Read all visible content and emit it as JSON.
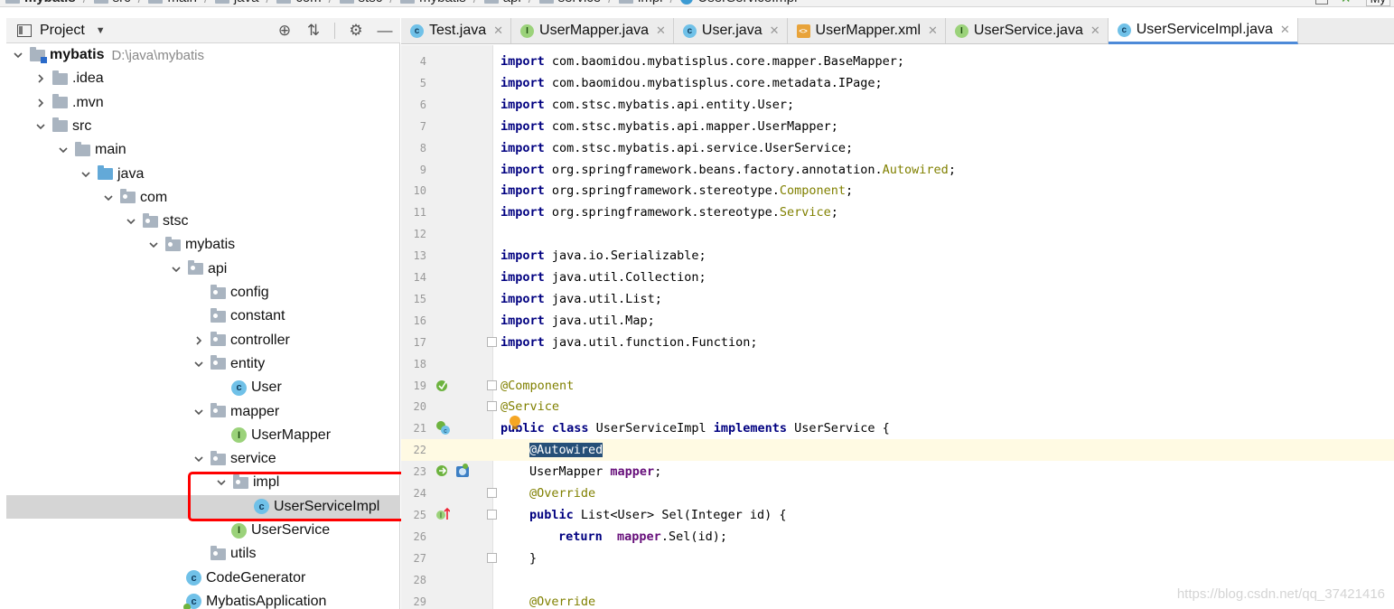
{
  "breadcrumb": {
    "items": [
      "mybatis",
      "src",
      "main",
      "java",
      "com",
      "stsc",
      "mybatis",
      "api",
      "service",
      "impl",
      "UserServiceImpl"
    ],
    "run_config": "My"
  },
  "project_panel": {
    "title": "Project",
    "tools": [
      "locate-icon",
      "collapse-icon",
      "gear-icon",
      "minimize-icon"
    ]
  },
  "tree": [
    {
      "label": "mybatis",
      "path": "D:\\java\\mybatis",
      "bold": true,
      "icon": "module-folder",
      "indent": 0,
      "arrow": "down"
    },
    {
      "label": ".idea",
      "icon": "folder",
      "indent": 1,
      "arrow": "right"
    },
    {
      "label": ".mvn",
      "icon": "folder",
      "indent": 1,
      "arrow": "right"
    },
    {
      "label": "src",
      "icon": "folder",
      "indent": 1,
      "arrow": "down"
    },
    {
      "label": "main",
      "icon": "folder",
      "indent": 2,
      "arrow": "down"
    },
    {
      "label": "java",
      "icon": "source-folder",
      "indent": 3,
      "arrow": "down"
    },
    {
      "label": "com",
      "icon": "package",
      "indent": 4,
      "arrow": "down"
    },
    {
      "label": "stsc",
      "icon": "package",
      "indent": 5,
      "arrow": "down"
    },
    {
      "label": "mybatis",
      "icon": "package",
      "indent": 6,
      "arrow": "down"
    },
    {
      "label": "api",
      "icon": "package",
      "indent": 7,
      "arrow": "down"
    },
    {
      "label": "config",
      "icon": "package",
      "indent": 8,
      "arrow": "none"
    },
    {
      "label": "constant",
      "icon": "package",
      "indent": 8,
      "arrow": "none"
    },
    {
      "label": "controller",
      "icon": "package",
      "indent": 8,
      "arrow": "right"
    },
    {
      "label": "entity",
      "icon": "package",
      "indent": 8,
      "arrow": "down"
    },
    {
      "label": "User",
      "icon": "class",
      "indent": 9,
      "arrow": "none"
    },
    {
      "label": "mapper",
      "icon": "package",
      "indent": 8,
      "arrow": "down"
    },
    {
      "label": "UserMapper",
      "icon": "interface",
      "indent": 9,
      "arrow": "none"
    },
    {
      "label": "service",
      "icon": "package",
      "indent": 8,
      "arrow": "down"
    },
    {
      "label": "impl",
      "icon": "package",
      "indent": 9,
      "arrow": "down"
    },
    {
      "label": "UserServiceImpl",
      "icon": "class",
      "indent": 10,
      "arrow": "none",
      "selected": true
    },
    {
      "label": "UserService",
      "icon": "interface",
      "indent": 9,
      "arrow": "none"
    },
    {
      "label": "utils",
      "icon": "package",
      "indent": 8,
      "arrow": "none"
    },
    {
      "label": "CodeGenerator",
      "icon": "class",
      "indent": 7,
      "arrow": "none"
    },
    {
      "label": "MybatisApplication",
      "icon": "spring-class",
      "indent": 7,
      "arrow": "none"
    }
  ],
  "tabs": [
    {
      "label": "Test.java",
      "icon": "class"
    },
    {
      "label": "UserMapper.java",
      "icon": "interface"
    },
    {
      "label": "User.java",
      "icon": "class"
    },
    {
      "label": "UserMapper.xml",
      "icon": "xml"
    },
    {
      "label": "UserService.java",
      "icon": "interface"
    },
    {
      "label": "UserServiceImpl.java",
      "icon": "class",
      "active": true
    }
  ],
  "code_lines": [
    {
      "n": "4",
      "indent": 0,
      "tokens": [
        [
          "kw",
          "import"
        ],
        [
          "t",
          " com.baomidou.mybatisplus.core.mapper.BaseMapper;"
        ]
      ]
    },
    {
      "n": "5",
      "indent": 0,
      "tokens": [
        [
          "kw",
          "import"
        ],
        [
          "t",
          " com.baomidou.mybatisplus.core.metadata.IPage;"
        ]
      ]
    },
    {
      "n": "6",
      "indent": 0,
      "tokens": [
        [
          "kw",
          "import"
        ],
        [
          "t",
          " com.stsc.mybatis.api.entity.User;"
        ]
      ]
    },
    {
      "n": "7",
      "indent": 0,
      "tokens": [
        [
          "kw",
          "import"
        ],
        [
          "t",
          " com.stsc.mybatis.api.mapper.UserMapper;"
        ]
      ]
    },
    {
      "n": "8",
      "indent": 0,
      "tokens": [
        [
          "kw",
          "import"
        ],
        [
          "t",
          " com.stsc.mybatis.api.service.UserService;"
        ]
      ]
    },
    {
      "n": "9",
      "indent": 0,
      "tokens": [
        [
          "kw",
          "import"
        ],
        [
          "t",
          " org.springframework.beans.factory.annotation."
        ],
        [
          "ann",
          "Autowired"
        ],
        [
          "t",
          ";"
        ]
      ]
    },
    {
      "n": "10",
      "indent": 0,
      "tokens": [
        [
          "kw",
          "import"
        ],
        [
          "t",
          " org.springframework.stereotype."
        ],
        [
          "ann",
          "Component"
        ],
        [
          "t",
          ";"
        ]
      ]
    },
    {
      "n": "11",
      "indent": 0,
      "tokens": [
        [
          "kw",
          "import"
        ],
        [
          "t",
          " org.springframework.stereotype."
        ],
        [
          "ann",
          "Service"
        ],
        [
          "t",
          ";"
        ]
      ]
    },
    {
      "n": "12",
      "indent": 0,
      "tokens": []
    },
    {
      "n": "13",
      "indent": 0,
      "tokens": [
        [
          "kw",
          "import"
        ],
        [
          "t",
          " java.io.Serializable;"
        ]
      ]
    },
    {
      "n": "14",
      "indent": 0,
      "tokens": [
        [
          "kw",
          "import"
        ],
        [
          "t",
          " java.util.Collection;"
        ]
      ]
    },
    {
      "n": "15",
      "indent": 0,
      "tokens": [
        [
          "kw",
          "import"
        ],
        [
          "t",
          " java.util.List;"
        ]
      ]
    },
    {
      "n": "16",
      "indent": 0,
      "tokens": [
        [
          "kw",
          "import"
        ],
        [
          "t",
          " java.util.Map;"
        ]
      ]
    },
    {
      "n": "17",
      "indent": 0,
      "tokens": [
        [
          "kw",
          "import"
        ],
        [
          "t",
          " java.util.function.Function;"
        ]
      ],
      "fold": true
    },
    {
      "n": "18",
      "indent": 0,
      "tokens": []
    },
    {
      "n": "19",
      "indent": 0,
      "tokens": [
        [
          "ann",
          "@Component"
        ]
      ],
      "fold": true,
      "gutter": "spring-bean-icon"
    },
    {
      "n": "20",
      "indent": 0,
      "tokens": [
        [
          "ann",
          "@Service"
        ]
      ],
      "fold": true
    },
    {
      "n": "21",
      "indent": 0,
      "tokens": [
        [
          "kw",
          "public class"
        ],
        [
          "t",
          " UserServiceImpl "
        ],
        [
          "kw",
          "implements"
        ],
        [
          "t",
          " UserService {"
        ]
      ],
      "gutter": "spring-class-icon",
      "bulb": true
    },
    {
      "n": "22",
      "indent": 1,
      "tokens": [
        [
          "sel",
          "@Autowired"
        ]
      ],
      "current": true
    },
    {
      "n": "23",
      "indent": 1,
      "tokens": [
        [
          "t",
          "UserMapper "
        ],
        [
          "fld",
          "mapper"
        ],
        [
          "t",
          ";"
        ]
      ],
      "gutter": "autowired-icon"
    },
    {
      "n": "24",
      "indent": 1,
      "tokens": [
        [
          "ann",
          "@Override"
        ]
      ],
      "fold": true
    },
    {
      "n": "25",
      "indent": 1,
      "tokens": [
        [
          "kw",
          "public"
        ],
        [
          "t",
          " List<User> Sel(Integer id) {"
        ]
      ],
      "gutter": "implements-icon",
      "fold": true
    },
    {
      "n": "26",
      "indent": 2,
      "tokens": [
        [
          "kw",
          "return"
        ],
        [
          "t",
          "  "
        ],
        [
          "fld",
          "mapper"
        ],
        [
          "t",
          ".Sel(id);"
        ]
      ]
    },
    {
      "n": "27",
      "indent": 1,
      "tokens": [
        [
          "t",
          "}"
        ]
      ],
      "fold": true
    },
    {
      "n": "28",
      "indent": 0,
      "tokens": []
    },
    {
      "n": "29",
      "indent": 1,
      "tokens": [
        [
          "ann",
          "@Override"
        ]
      ]
    }
  ],
  "watermark": "https://blog.csdn.net/qq_37421416"
}
